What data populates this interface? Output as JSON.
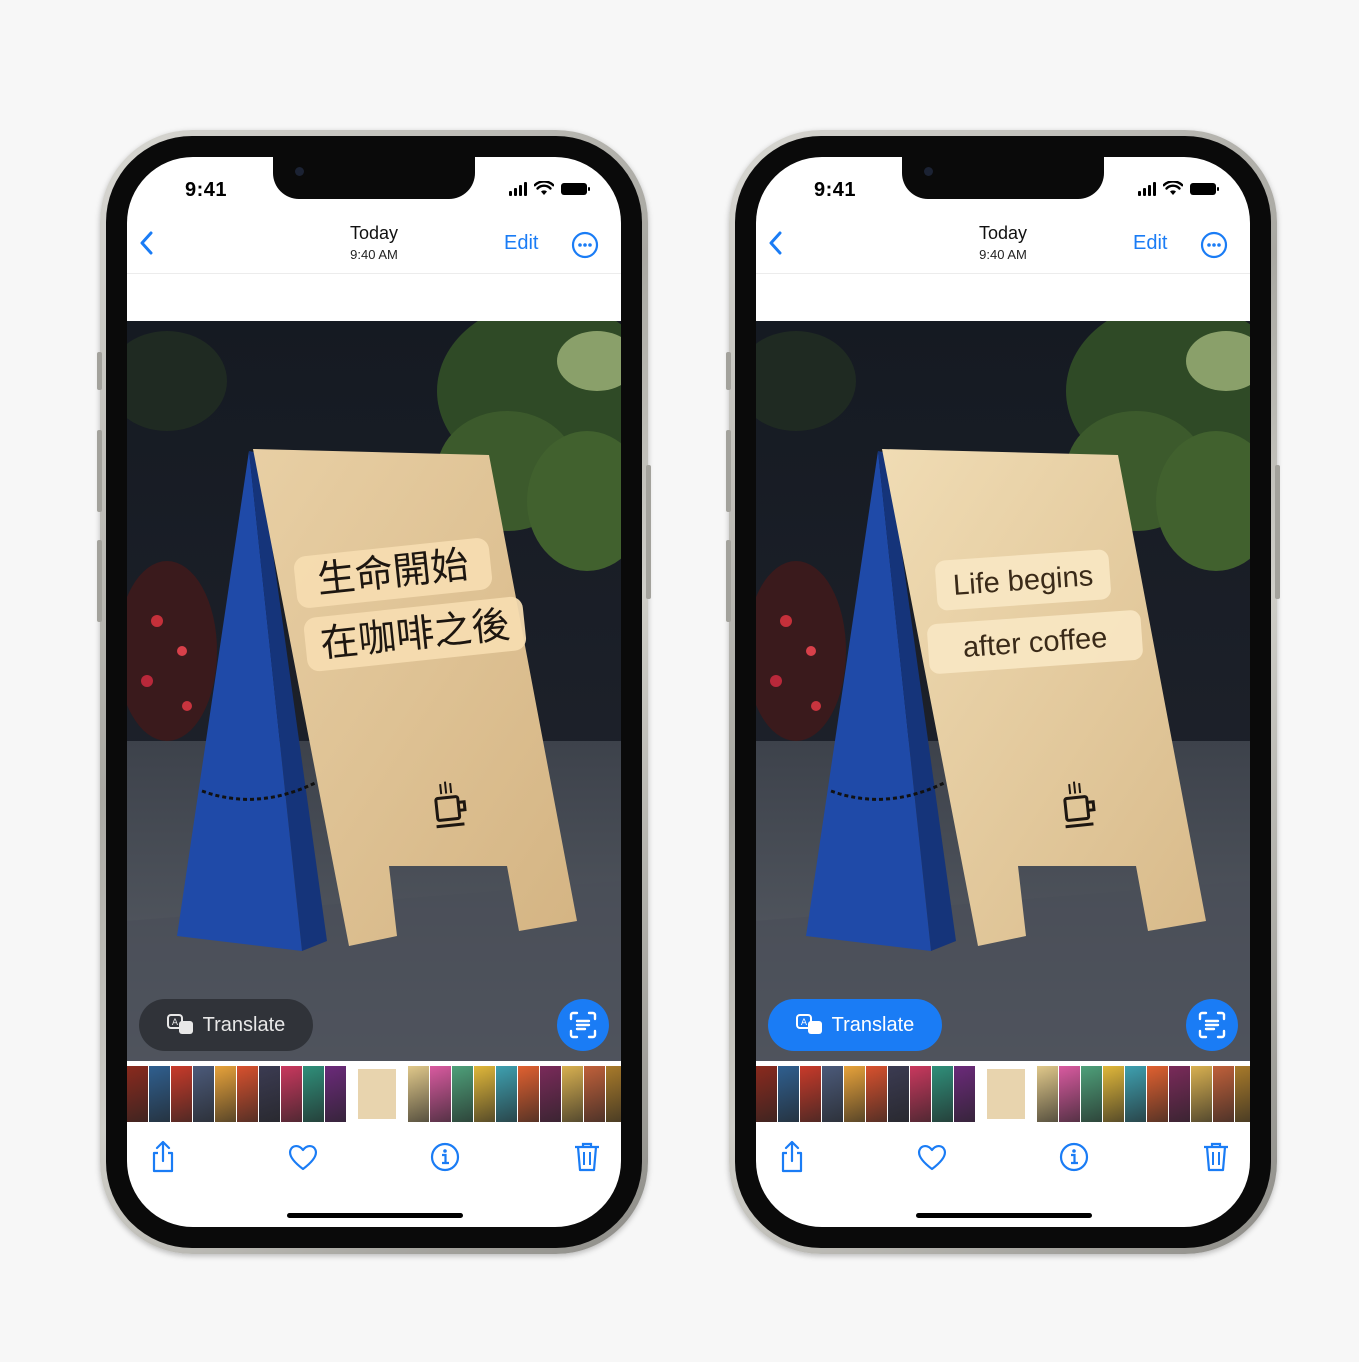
{
  "background_color": "#f7f7f7",
  "accent_color": "#1a7cf5",
  "phones": [
    {
      "id": "original",
      "status_bar": {
        "time": "9:41",
        "icons": [
          "cellular-signal-icon",
          "wifi-icon",
          "battery-icon"
        ]
      },
      "nav": {
        "back_icon": "chevron-left-icon",
        "title": "Today",
        "subtitle": "9:40 AM",
        "edit_label": "Edit",
        "more_icon": "ellipsis-circle-icon"
      },
      "photo": {
        "description_icon": "coffee-cup-icon",
        "sign_lines": [
          "生命開始",
          "在咖啡之後"
        ]
      },
      "translate": {
        "label": "Translate",
        "icon": "translate-icon",
        "state": "off"
      },
      "live_text_icon": "live-text-icon",
      "toolbar": [
        "share-icon",
        "heart-icon",
        "info-icon",
        "trash-icon"
      ]
    },
    {
      "id": "translated",
      "status_bar": {
        "time": "9:41",
        "icons": [
          "cellular-signal-icon",
          "wifi-icon",
          "battery-icon"
        ]
      },
      "nav": {
        "back_icon": "chevron-left-icon",
        "title": "Today",
        "subtitle": "9:40 AM",
        "edit_label": "Edit",
        "more_icon": "ellipsis-circle-icon"
      },
      "photo": {
        "description_icon": "coffee-cup-icon",
        "sign_lines": [
          "Life begins",
          "after coffee"
        ]
      },
      "translate": {
        "label": "Translate",
        "icon": "translate-icon",
        "state": "on"
      },
      "live_text_icon": "live-text-icon",
      "toolbar": [
        "share-icon",
        "heart-icon",
        "info-icon",
        "trash-icon"
      ]
    }
  ],
  "thumbnail_colors": [
    "#8a2a1e",
    "#2f5f8f",
    "#c83a2a",
    "#4b5a7a",
    "#e7a23a",
    "#d8512e",
    "#3b3b52",
    "#c9385e",
    "#2f8f7a",
    "#6b2a7a",
    "#ffffff",
    "#e0c88a",
    "#d95aa0",
    "#4ea07a",
    "#e0b73a",
    "#3ea0b0",
    "#e06030",
    "#7a2a5a",
    "#d8b050",
    "#c0603a",
    "#a87a2a",
    "#d82a3a"
  ]
}
